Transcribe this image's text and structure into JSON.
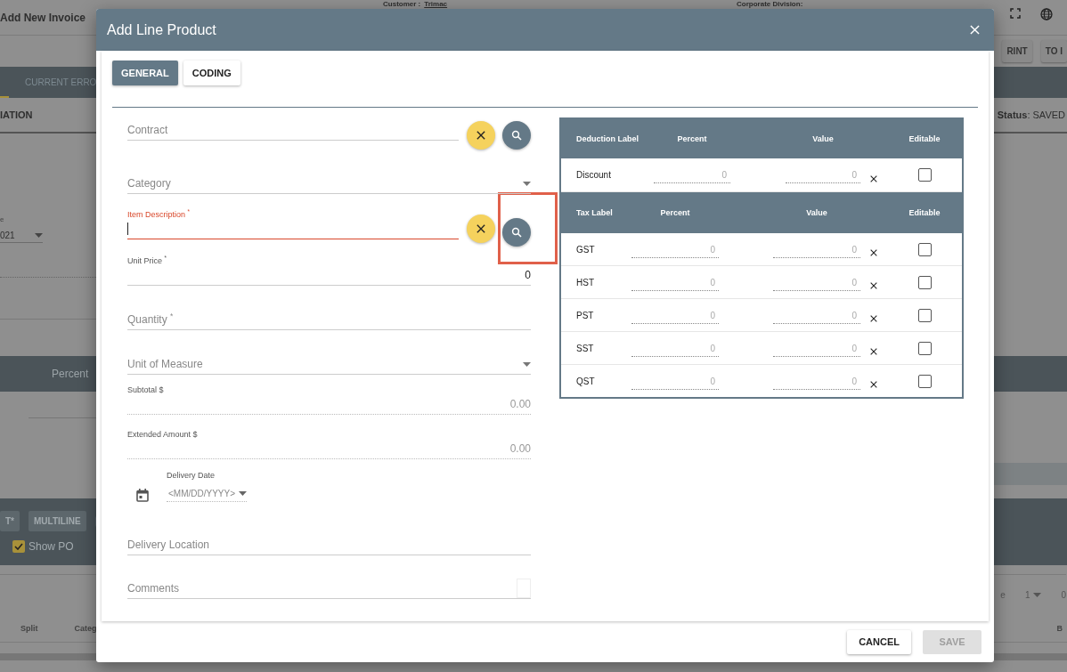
{
  "background": {
    "title": "Add New Invoice",
    "customer_label": "Customer :",
    "customer_link": "Trimac",
    "division": "Corporate Division:",
    "top_buttons": [
      "RINT",
      "TO I"
    ],
    "tabs": [
      {
        "label": "CURRENT ERRO",
        "selected": false
      }
    ],
    "section_title": "IATION",
    "status": "**Status**: SAVED",
    "date_label": "e",
    "date_value": "021",
    "band_heading": "Percent",
    "toolbar_buttons": [
      "T*",
      "MULTILINE"
    ],
    "checkboxes": [
      {
        "label": "Show PO",
        "checked": true
      }
    ],
    "pager": {
      "label": "e",
      "page": "1",
      "count": "0"
    },
    "columns": [
      "Split",
      "Categ",
      "B"
    ]
  },
  "dialog": {
    "title": "Add Line Product",
    "tabs": [
      {
        "label": "GENERAL",
        "selected": true
      },
      {
        "label": "CODING",
        "selected": false
      }
    ],
    "fields": [
      {
        "kind": "lookup",
        "placeholder": "Contract",
        "focused": false,
        "highlighted": false
      },
      {
        "kind": "select",
        "placeholder": "Category"
      },
      {
        "kind": "lookup",
        "label": "Item Description $^{*}$",
        "focused": true,
        "highlighted": true
      },
      {
        "kind": "number",
        "label": "Unit Price $^{*}$",
        "value": "0"
      },
      {
        "kind": "text",
        "placeholder": "Quantity $^{*}$"
      },
      {
        "kind": "select",
        "placeholder": "Unit of Measure"
      },
      {
        "kind": "readonly",
        "label": "Subtotal $",
        "value": "0.00"
      },
      {
        "kind": "readonly",
        "label": "Extended Amount $",
        "value": "0.00"
      },
      {
        "kind": "date",
        "label": "Delivery Date",
        "placeholder": "<MM/DD/YYYY>"
      },
      {
        "kind": "text",
        "placeholder": "Delivery Location"
      },
      {
        "kind": "textarea",
        "placeholder": "Comments"
      }
    ],
    "deductions": {
      "columns": [
        "Deduction Label",
        "Percent",
        "Value",
        "Editable"
      ],
      "rows": [
        {
          "label": "Discount",
          "percent": "0",
          "value": "0",
          "editable": false
        }
      ]
    },
    "taxes": {
      "columns": [
        "Tax Label",
        "Percent",
        "Value",
        "Editable"
      ],
      "rows": [
        {
          "label": "GST",
          "percent": "0",
          "value": "0",
          "editable": false
        },
        {
          "label": "HST",
          "percent": "0",
          "value": "0",
          "editable": false
        },
        {
          "label": "PST",
          "percent": "0",
          "value": "0",
          "editable": false
        },
        {
          "label": "SST",
          "percent": "0",
          "value": "0",
          "editable": false
        },
        {
          "label": "QST",
          "percent": "0",
          "value": "0",
          "editable": false
        }
      ]
    },
    "buttons": [
      {
        "label": "CANCEL",
        "disabled": false
      },
      {
        "label": "SAVE",
        "disabled": true
      }
    ]
  }
}
